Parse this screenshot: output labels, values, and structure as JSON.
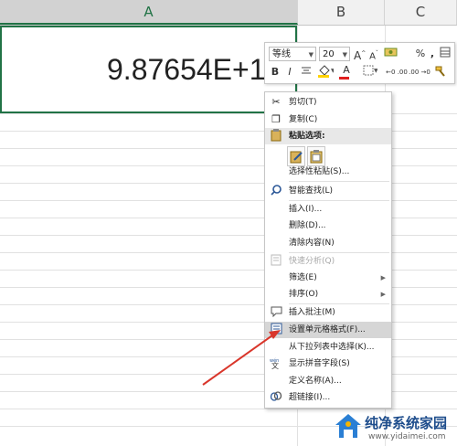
{
  "columns": [
    "A",
    "B",
    "C"
  ],
  "cell": {
    "value": "9.87654E+12"
  },
  "mini_toolbar": {
    "font_name": "等线",
    "font_size": "20",
    "increase_font": "A",
    "decrease_font": "A",
    "percent": "%",
    "comma": ",",
    "bold": "B",
    "italic": "I",
    "font_color_letter": "A",
    "decimal_increase": "←0 .00",
    "decimal_decrease": ".00 →0"
  },
  "context_menu": {
    "items": [
      {
        "label": "剪切(T)",
        "icon": "cut-icon",
        "glyph": "✂"
      },
      {
        "label": "复制(C)",
        "icon": "copy-icon",
        "glyph": "❐"
      },
      {
        "label": "粘贴选项:",
        "icon": "paste-icon",
        "glyph": "📋"
      },
      {
        "label": "选择性粘贴(S)...",
        "icon": "",
        "glyph": ""
      },
      {
        "label": "智能查找(L)",
        "icon": "smart-lookup-icon",
        "glyph": "⚲"
      },
      {
        "label": "插入(I)...",
        "icon": "",
        "glyph": ""
      },
      {
        "label": "删除(D)...",
        "icon": "",
        "glyph": ""
      },
      {
        "label": "清除内容(N)",
        "icon": "",
        "glyph": ""
      },
      {
        "label": "快速分析(Q)",
        "icon": "quick-analysis-icon",
        "glyph": "▦"
      },
      {
        "label": "筛选(E)",
        "icon": "",
        "glyph": ""
      },
      {
        "label": "排序(O)",
        "icon": "",
        "glyph": ""
      },
      {
        "label": "插入批注(M)",
        "icon": "insert-comment-icon",
        "glyph": "🗨"
      },
      {
        "label": "设置单元格格式(F)...",
        "icon": "format-cells-icon",
        "glyph": "☷"
      },
      {
        "label": "从下拉列表中选择(K)...",
        "icon": "",
        "glyph": ""
      },
      {
        "label": "显示拼音字段(S)",
        "icon": "phonetic-icon",
        "glyph": "文"
      },
      {
        "label": "定义名称(A)...",
        "icon": "",
        "glyph": ""
      },
      {
        "label": "超链接(I)...",
        "icon": "hyperlink-icon",
        "glyph": "∞"
      }
    ]
  },
  "watermark": {
    "title": "纯净系统家园",
    "url": "www.yidaimei.com"
  },
  "colors": {
    "accent_green": "#217346",
    "arrow_red": "#d9362b",
    "watermark_blue": "#1e4d8c"
  }
}
